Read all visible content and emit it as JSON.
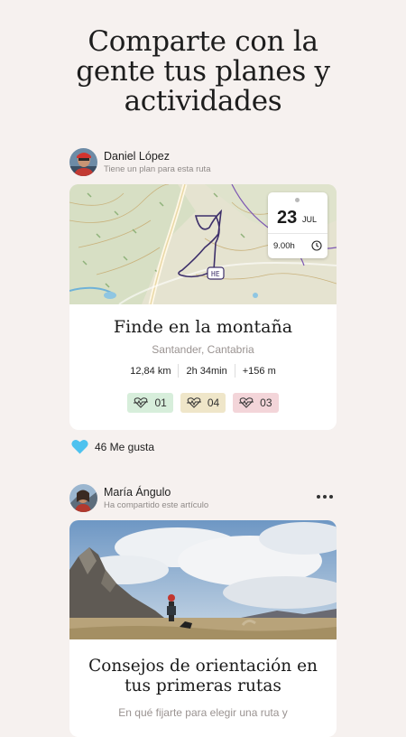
{
  "headline": {
    "line1": "Comparte con la",
    "line2": "gente tus planes y",
    "line3": "actividades"
  },
  "post1": {
    "author": "Daniel López",
    "subtitle": "Tiene un plan para esta ruta",
    "date": {
      "day": "23",
      "month": "JUL",
      "time": "9.00h"
    },
    "title": "Finde en la montaña",
    "location": "Santander, Cantabria",
    "stats": {
      "distance": "12,84 km",
      "duration": "2h 34min",
      "elevation": "+156 m"
    },
    "badges": [
      {
        "value": "01",
        "color": "#d7eedb",
        "icon": "heart-pulse-icon"
      },
      {
        "value": "04",
        "color": "#efe6c9",
        "icon": "heart-pulse-icon"
      },
      {
        "value": "03",
        "color": "#f3d5d9",
        "icon": "heart-pulse-icon"
      }
    ],
    "likes": "46 Me gusta",
    "accent_like": "#4ec2ef"
  },
  "post2": {
    "author": "María Ángulo",
    "subtitle": "Ha compartido este artículo",
    "title_line1": "Consejos de orientación en",
    "title_line2": "tus primeras rutas",
    "summary": "En qué fijarte para elegir una ruta y"
  }
}
